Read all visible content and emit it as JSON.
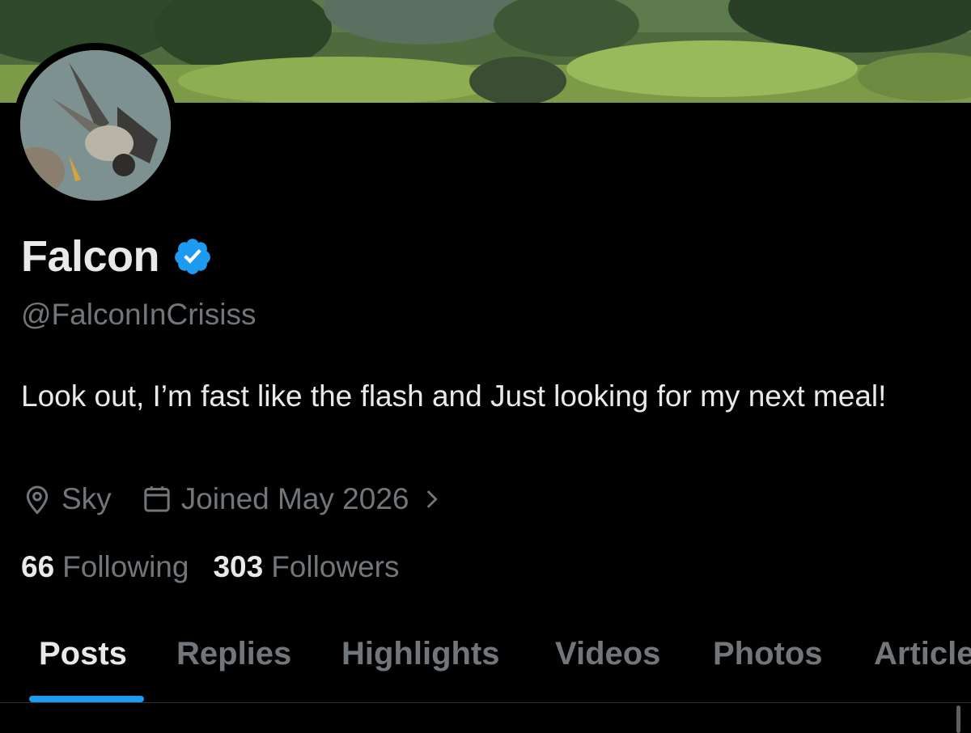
{
  "profile": {
    "display_name": "Falcon",
    "handle": "@FalconInCrisiss",
    "bio": "Look out, I’m fast like the flash and Just looking for my next meal!",
    "location": "Sky",
    "joined": "Joined May 2026",
    "following_count": "66",
    "following_label": "Following",
    "followers_count": "303",
    "followers_label": "Followers"
  },
  "tabs": [
    {
      "label": "Posts",
      "active": true
    },
    {
      "label": "Replies",
      "active": false
    },
    {
      "label": "Highlights",
      "active": false
    },
    {
      "label": "Videos",
      "active": false
    },
    {
      "label": "Photos",
      "active": false
    },
    {
      "label": "Articles",
      "active": false
    }
  ],
  "icons": {
    "verified": "verified-badge-icon",
    "location": "location-pin-icon",
    "calendar": "calendar-icon",
    "chevron": "chevron-right-icon"
  },
  "colors": {
    "background": "#000000",
    "primary_text": "#e7e9ea",
    "secondary_text": "#71767b",
    "accent": "#1d9bf0"
  }
}
